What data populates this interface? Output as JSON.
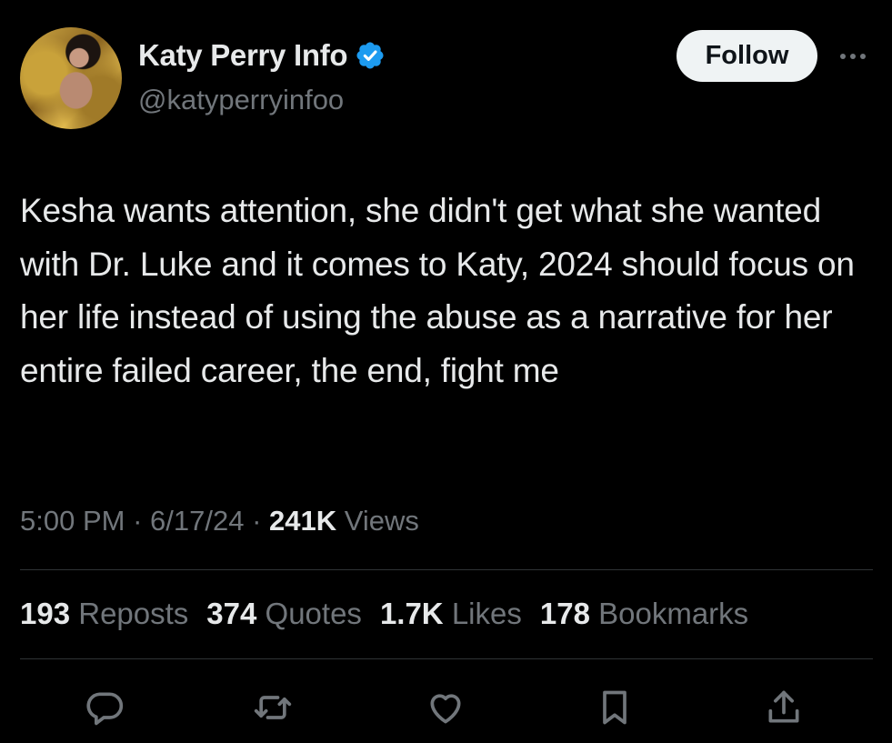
{
  "author": {
    "display_name": "Katy Perry Info",
    "handle": "@katyperryinfoo",
    "avatar_icon": "profile-photo-icon",
    "verified_icon": "verified-badge-icon",
    "verified_color": "#1d9bf0"
  },
  "follow_label": "Follow",
  "more_icon": "more-options-icon",
  "tweet": {
    "text": "Kesha wants attention, she didn't get what she wanted with Dr. Luke and it comes to Katy, 2024 should focus on her life instead of using the abuse as a narrative for her entire failed career, the end, fight me"
  },
  "meta": {
    "time": "5:00 PM",
    "sep1": "·",
    "date": "6/17/24",
    "sep2": "·",
    "views_count": "241K",
    "views_label": "Views"
  },
  "stats": [
    {
      "count": "193",
      "label": "Reposts"
    },
    {
      "count": "374",
      "label": "Quotes"
    },
    {
      "count": "1.7K",
      "label": "Likes"
    },
    {
      "count": "178",
      "label": "Bookmarks"
    }
  ],
  "actions": [
    "reply-icon",
    "repost-icon",
    "like-icon",
    "bookmark-icon",
    "share-icon"
  ],
  "colors": {
    "background": "#000000",
    "text": "#e7e9ea",
    "secondary": "#71767b",
    "divider": "#2f3336",
    "follow_bg": "#eff3f4"
  }
}
